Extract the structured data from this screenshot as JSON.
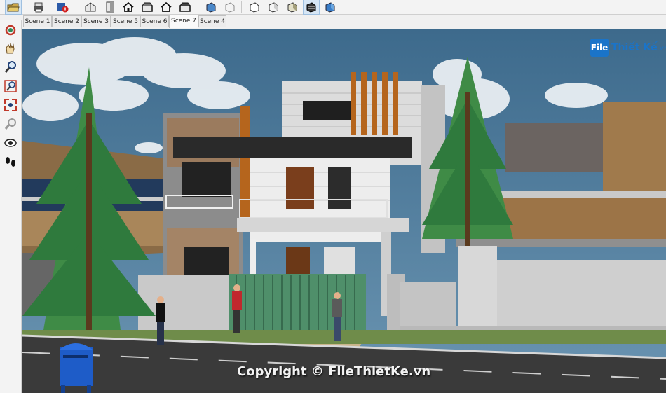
{
  "toolbar": {
    "buttons": [
      "open-icon",
      "print-icon",
      "model-info-icon",
      "iso-view-icon",
      "top-view-icon",
      "front-view-icon",
      "right-view-icon",
      "back-view-icon",
      "left-view-icon",
      "xray-icon",
      "wireframe-icon",
      "hidden-line-icon",
      "shaded-icon",
      "shaded-texture-icon",
      "monochrome-icon"
    ]
  },
  "scenes": {
    "tabs": [
      "Scene 1",
      "Scene 2",
      "Scene 3",
      "Scene 5",
      "Scene 6",
      "Scene 7",
      "Scene 4"
    ],
    "active": "Scene 7"
  },
  "left_toolbar": {
    "tools": [
      "orbit-icon",
      "pan-icon",
      "zoom-icon",
      "zoom-window-icon",
      "zoom-extents-icon",
      "previous-view-icon",
      "look-around-icon",
      "walk-icon"
    ]
  },
  "watermark": {
    "logo_mark": "File",
    "logo_text": "Thiết Kế",
    "logo_domain": ".vn",
    "copyright": "Copyright © FileThietKe.vn"
  },
  "colors": {
    "sky": "#3f6f91",
    "road": "#3a3a3a",
    "brand": "#1a74c9"
  }
}
